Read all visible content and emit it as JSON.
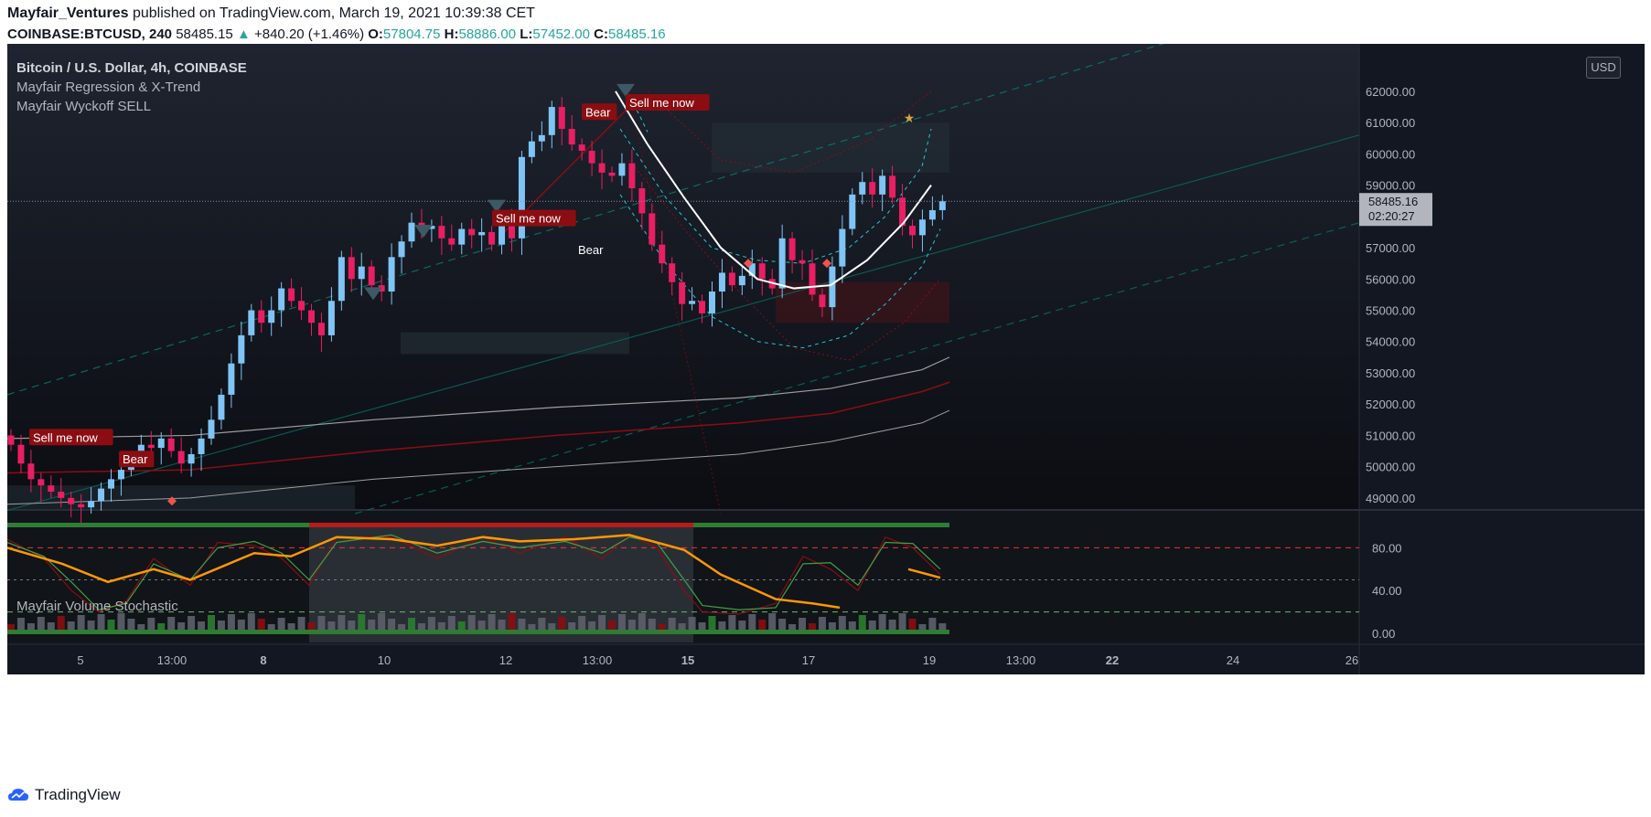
{
  "header": {
    "author": "Mayfair_Ventures",
    "published_text": "published on TradingView.com, March 19, 2021 10:39:38 CET",
    "symbol": "COINBASE:BTCUSD, 240",
    "last": "58485.15",
    "change": "+840.20 (+1.46%)",
    "o_label": "O:",
    "o": "57804.75",
    "h_label": "H:",
    "h": "58886.00",
    "l_label": "L:",
    "l": "57452.00",
    "c_label": "C:",
    "c": "58485.16"
  },
  "legend": {
    "main": "Bitcoin / U.S. Dollar, 4h, COINBASE",
    "ind1": "Mayfair Regression & X-Trend",
    "ind2": "Mayfair Wyckoff SELL"
  },
  "currency": "USD",
  "oscillator_title": "Mayfair Volume Stochastic",
  "footer": {
    "brand": "TradingView"
  },
  "colors": {
    "background": "#131722",
    "up": "#7fc4f5",
    "down": "#e91e63",
    "stoch_orange": "#ff9800",
    "band_cyan": "#26c6da",
    "regression_white": "#ffffff",
    "sell_label": "#8b0d12",
    "overbought": "#e53935",
    "oversold": "#43a047"
  },
  "chart_data": [
    {
      "type": "candlestick",
      "y_ticks": [
        49000,
        50000,
        51000,
        52000,
        53000,
        54000,
        55000,
        56000,
        57000,
        58000,
        59000,
        60000,
        61000,
        62000
      ],
      "y_tick_labels": [
        "49000.00",
        "50000.00",
        "51000.00",
        "52000.00",
        "53000.00",
        "54000.00",
        "55000.00",
        "56000.00",
        "57000.00",
        "58000.00",
        "59000.00",
        "60000.00",
        "61000.00",
        "62000.00"
      ],
      "x_tick_labels": [
        "5",
        "13:00",
        "8",
        "10",
        "12",
        "13:00",
        "15",
        "17",
        "19",
        "13:00",
        "22",
        "24",
        "26"
      ],
      "x_tick_bold": [
        false,
        false,
        true,
        false,
        false,
        false,
        true,
        false,
        false,
        false,
        true,
        false,
        false
      ],
      "last_price_label": "58485.16",
      "countdown_label": "02:20:27",
      "last_price": 58485.16,
      "annotations": [
        {
          "text": "Sell me now",
          "kind": "box"
        },
        {
          "text": "Bear",
          "kind": "box"
        },
        {
          "text": "Sell me now",
          "kind": "box"
        },
        {
          "text": "Bear",
          "kind": "text"
        },
        {
          "text": "Bear",
          "kind": "box"
        },
        {
          "text": "Sell me now",
          "kind": "box"
        }
      ],
      "closes": [
        50700,
        50100,
        49600,
        49400,
        49200,
        49000,
        48800,
        48700,
        48900,
        49300,
        49600,
        49900,
        50300,
        50700,
        50600,
        50900,
        50500,
        50100,
        50400,
        50900,
        51500,
        52300,
        53300,
        54200,
        55000,
        54600,
        55000,
        55700,
        55300,
        55000,
        54600,
        54200,
        55300,
        56700,
        56000,
        56400,
        55800,
        55600,
        56700,
        57200,
        57800,
        57600,
        57700,
        57300,
        57100,
        57600,
        57400,
        57500,
        57100,
        57800,
        57300,
        59900,
        60400,
        60600,
        61500,
        60800,
        60300,
        60100,
        59700,
        59400,
        59300,
        59700,
        58900,
        58100,
        57100,
        56500,
        55900,
        55200,
        55300,
        54900,
        55600,
        56200,
        55800,
        56100,
        56500,
        56000,
        55700,
        57300,
        56600,
        56500,
        55500,
        55100,
        56400,
        57600,
        58700,
        59100,
        58700,
        59300,
        58600,
        57700,
        57400,
        57900,
        58200,
        58485
      ],
      "opens": [
        51000,
        50700,
        50100,
        49600,
        49400,
        49200,
        49000,
        48800,
        48700,
        48900,
        49300,
        49600,
        49900,
        50300,
        50700,
        50600,
        50900,
        50500,
        50100,
        50400,
        50900,
        51500,
        52300,
        53300,
        54200,
        55000,
        54600,
        55000,
        55700,
        55300,
        55000,
        54600,
        54200,
        55300,
        56700,
        56000,
        56400,
        55800,
        55600,
        56700,
        57200,
        57800,
        57600,
        57700,
        57300,
        57100,
        57600,
        57400,
        57500,
        57100,
        57800,
        57300,
        59900,
        60400,
        60600,
        61500,
        60800,
        60300,
        60100,
        59700,
        59400,
        59300,
        59700,
        58900,
        58100,
        57100,
        56500,
        55900,
        55200,
        55300,
        54900,
        55600,
        56200,
        55800,
        56100,
        56500,
        56000,
        55700,
        57300,
        56600,
        56500,
        55500,
        55100,
        56400,
        57600,
        58700,
        59100,
        58700,
        59300,
        58600,
        57700,
        57400,
        57900,
        58200
      ],
      "stoch_ticks": [
        0,
        40,
        80
      ],
      "stoch_tick_labels": [
        "0.00",
        "40.00",
        "80.00"
      ],
      "stoch_levels": {
        "overbought": 80,
        "mid": 50,
        "oversold": 20
      }
    }
  ]
}
